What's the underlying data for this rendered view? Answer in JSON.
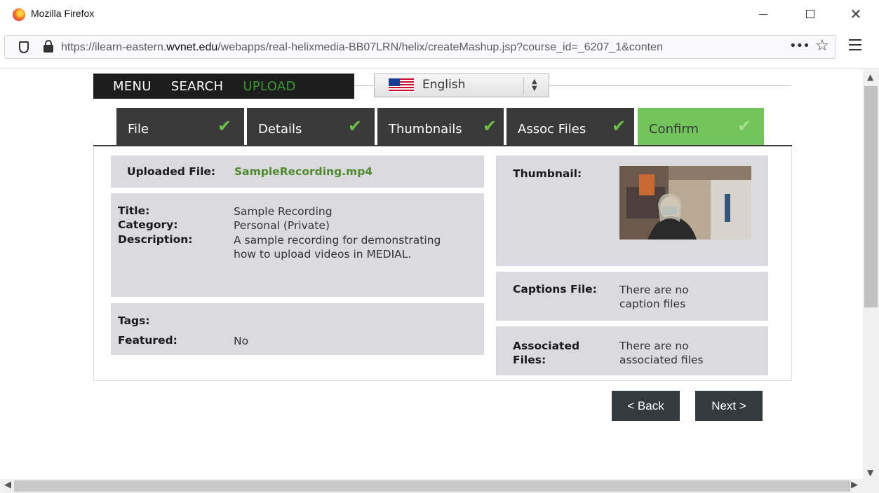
{
  "window": {
    "title": "Mozilla Firefox"
  },
  "browser": {
    "url_prefix": "https://ilearn-eastern.",
    "url_domain": "wvnet.edu",
    "url_rest": "/webapps/real-helixmedia-BB07LRN/helix/createMashup.jsp?course_id=_6207_1&conten",
    "more_icon": "•••",
    "star_icon": "☆"
  },
  "topmenu": {
    "menu": "MENU",
    "search": "SEARCH",
    "upload": "UPLOAD"
  },
  "language": {
    "selected": "English",
    "icon": "us-flag-icon"
  },
  "tabs": [
    {
      "label": "File",
      "check": "✔"
    },
    {
      "label": "Details",
      "check": "✔"
    },
    {
      "label": "Thumbnails",
      "check": "✔"
    },
    {
      "label": "Assoc Files",
      "check": "✔"
    },
    {
      "label": "Confirm",
      "check": "✔"
    }
  ],
  "colors": {
    "accent": "#72c55a",
    "dark": "#3a3a3a",
    "upload_active": "#3b9a2f",
    "file_link": "#4f8a2f",
    "box_bg": "#dadadf"
  },
  "summary": {
    "uploaded_file_label": "Uploaded File:",
    "uploaded_file_value": "SampleRecording.mp4",
    "title_label": "Title:",
    "title_value": "Sample Recording",
    "category_label": "Category:",
    "category_value": "Personal (Private)",
    "description_label": "Description:",
    "description_value": "A sample recording for demonstrating how to upload videos in MEDIAL.",
    "tags_label": "Tags:",
    "featured_label": "Featured:",
    "featured_value": "No",
    "thumbnail_label": "Thumbnail:",
    "captions_label": "Captions File:",
    "captions_value": "There are no caption files",
    "associated_label": "Associated Files:",
    "associated_value": "There are no associated files"
  },
  "buttons": {
    "back": "< Back",
    "next": "Next >"
  }
}
